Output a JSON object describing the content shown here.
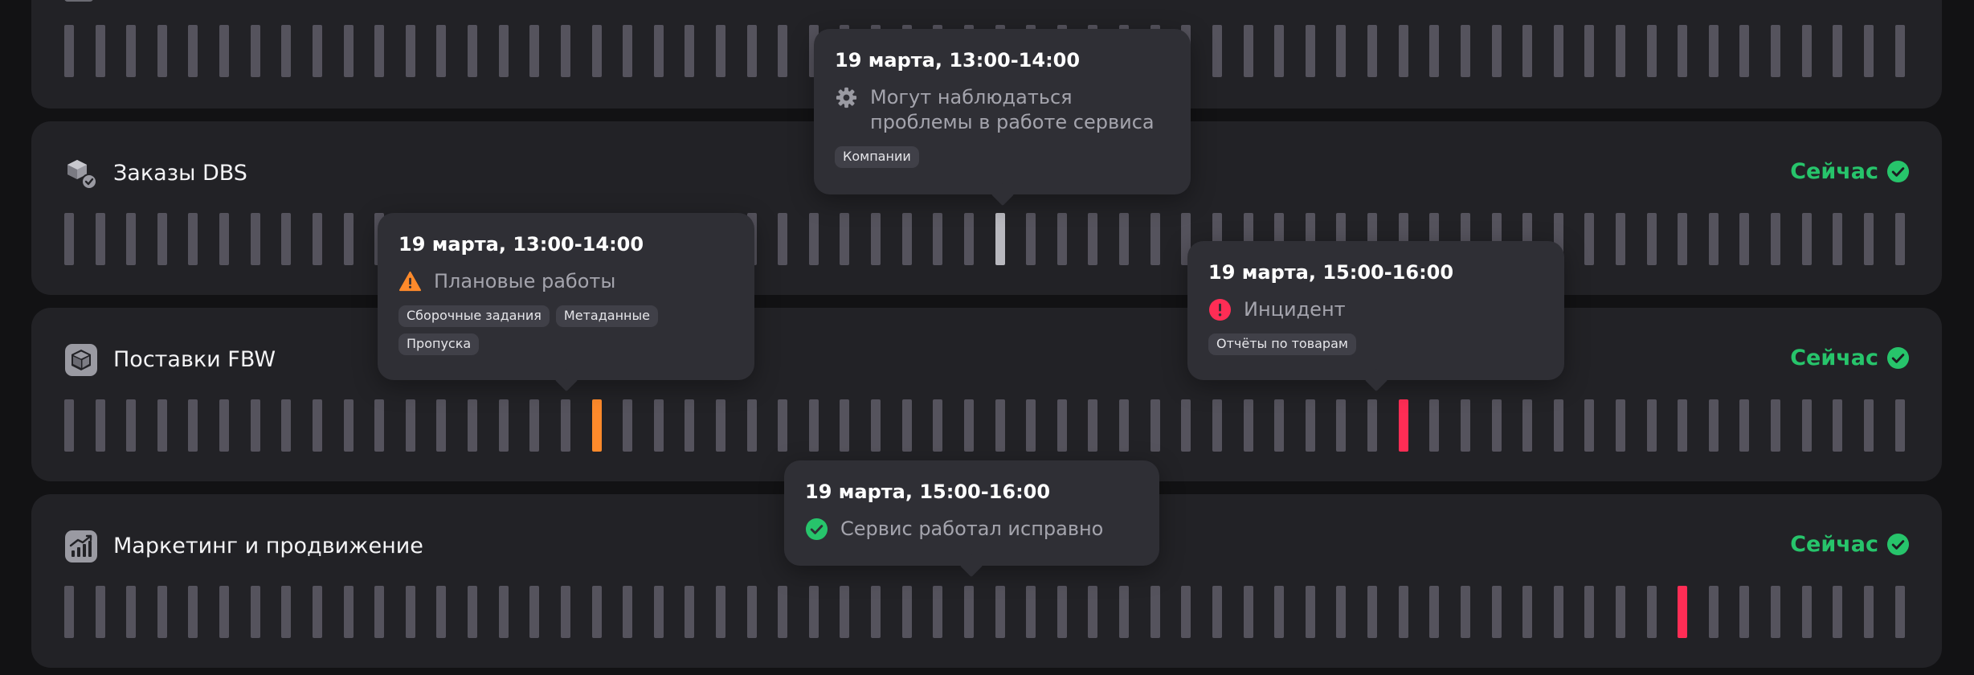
{
  "colors": {
    "bar_default": "#55535d",
    "bar_selected": "#b8b8be",
    "bar_warning": "#ff8a2b",
    "bar_incident": "#ff2d55",
    "status_ok": "#27c46b"
  },
  "services": [
    {
      "name": "",
      "status": "",
      "bars": [
        "n",
        "n",
        "n",
        "n",
        "n",
        "n",
        "n",
        "n",
        "n",
        "n",
        "n",
        "n",
        "n",
        "n",
        "n",
        "n",
        "n",
        "n",
        "n",
        "n",
        "n",
        "n",
        "n",
        "n",
        "n",
        "n",
        "n",
        "n",
        "n",
        "n",
        "n",
        "n",
        "n",
        "n",
        "n",
        "n",
        "n",
        "n",
        "n",
        "n",
        "n",
        "n",
        "n",
        "n",
        "n",
        "n",
        "n",
        "n",
        "n",
        "n",
        "n",
        "n",
        "n",
        "n",
        "n",
        "n",
        "n",
        "n",
        "n",
        "n"
      ]
    },
    {
      "name": "Заказы DBS",
      "icon": "boxes-check-icon",
      "status": "Сейчас",
      "bars": [
        "n",
        "n",
        "n",
        "n",
        "n",
        "n",
        "n",
        "n",
        "n",
        "n",
        "n",
        "n",
        "n",
        "n",
        "n",
        "n",
        "n",
        "n",
        "n",
        "n",
        "n",
        "n",
        "n",
        "n",
        "n",
        "n",
        "n",
        "n",
        "n",
        "n",
        "s",
        "n",
        "n",
        "n",
        "n",
        "n",
        "n",
        "n",
        "n",
        "n",
        "n",
        "n",
        "n",
        "n",
        "n",
        "n",
        "n",
        "n",
        "n",
        "n",
        "n",
        "n",
        "n",
        "n",
        "n",
        "n",
        "n",
        "n",
        "n",
        "n"
      ]
    },
    {
      "name": "Поставки FBW",
      "icon": "box-icon",
      "status": "Сейчас",
      "bars": [
        "n",
        "n",
        "n",
        "n",
        "n",
        "n",
        "n",
        "n",
        "n",
        "n",
        "n",
        "n",
        "n",
        "n",
        "n",
        "n",
        "n",
        "w",
        "n",
        "n",
        "n",
        "n",
        "n",
        "n",
        "n",
        "n",
        "n",
        "n",
        "n",
        "n",
        "n",
        "n",
        "n",
        "n",
        "n",
        "n",
        "n",
        "n",
        "n",
        "n",
        "n",
        "n",
        "n",
        "i",
        "n",
        "n",
        "n",
        "n",
        "n",
        "n",
        "n",
        "n",
        "n",
        "n",
        "n",
        "n",
        "n",
        "n",
        "n",
        "n"
      ]
    },
    {
      "name": "Маркетинг и продвижение",
      "icon": "growth-chart-icon",
      "status": "Сейчас",
      "bars": [
        "n",
        "n",
        "n",
        "n",
        "n",
        "n",
        "n",
        "n",
        "n",
        "n",
        "n",
        "n",
        "n",
        "n",
        "n",
        "n",
        "n",
        "n",
        "n",
        "n",
        "n",
        "n",
        "n",
        "n",
        "n",
        "n",
        "n",
        "n",
        "n",
        "n",
        "n",
        "n",
        "n",
        "n",
        "n",
        "n",
        "n",
        "n",
        "n",
        "n",
        "n",
        "n",
        "n",
        "n",
        "n",
        "n",
        "n",
        "n",
        "n",
        "n",
        "n",
        "n",
        "i",
        "n",
        "n",
        "n",
        "n",
        "n",
        "n",
        "n"
      ]
    }
  ],
  "tooltips": {
    "maintenance": {
      "date": "19 марта, 13:00-14:00",
      "message": "Могут наблюдаться проблемы в работе сервиса",
      "icon": "gear-icon",
      "tags": [
        "Компании"
      ]
    },
    "planned": {
      "date": "19 марта, 13:00-14:00",
      "message": "Плановые работы",
      "icon": "warning-triangle-icon",
      "tags": [
        "Сборочные задания",
        "Метаданные",
        "Пропуска"
      ]
    },
    "incident": {
      "date": "19 марта, 15:00-16:00",
      "message": "Инцидент",
      "icon": "error-circle-icon",
      "tags": [
        "Отчёты по товарам"
      ]
    },
    "ok": {
      "date": "19 марта, 15:00-16:00",
      "message": "Сервис работал исправно",
      "icon": "check-circle-icon",
      "tags": []
    }
  }
}
